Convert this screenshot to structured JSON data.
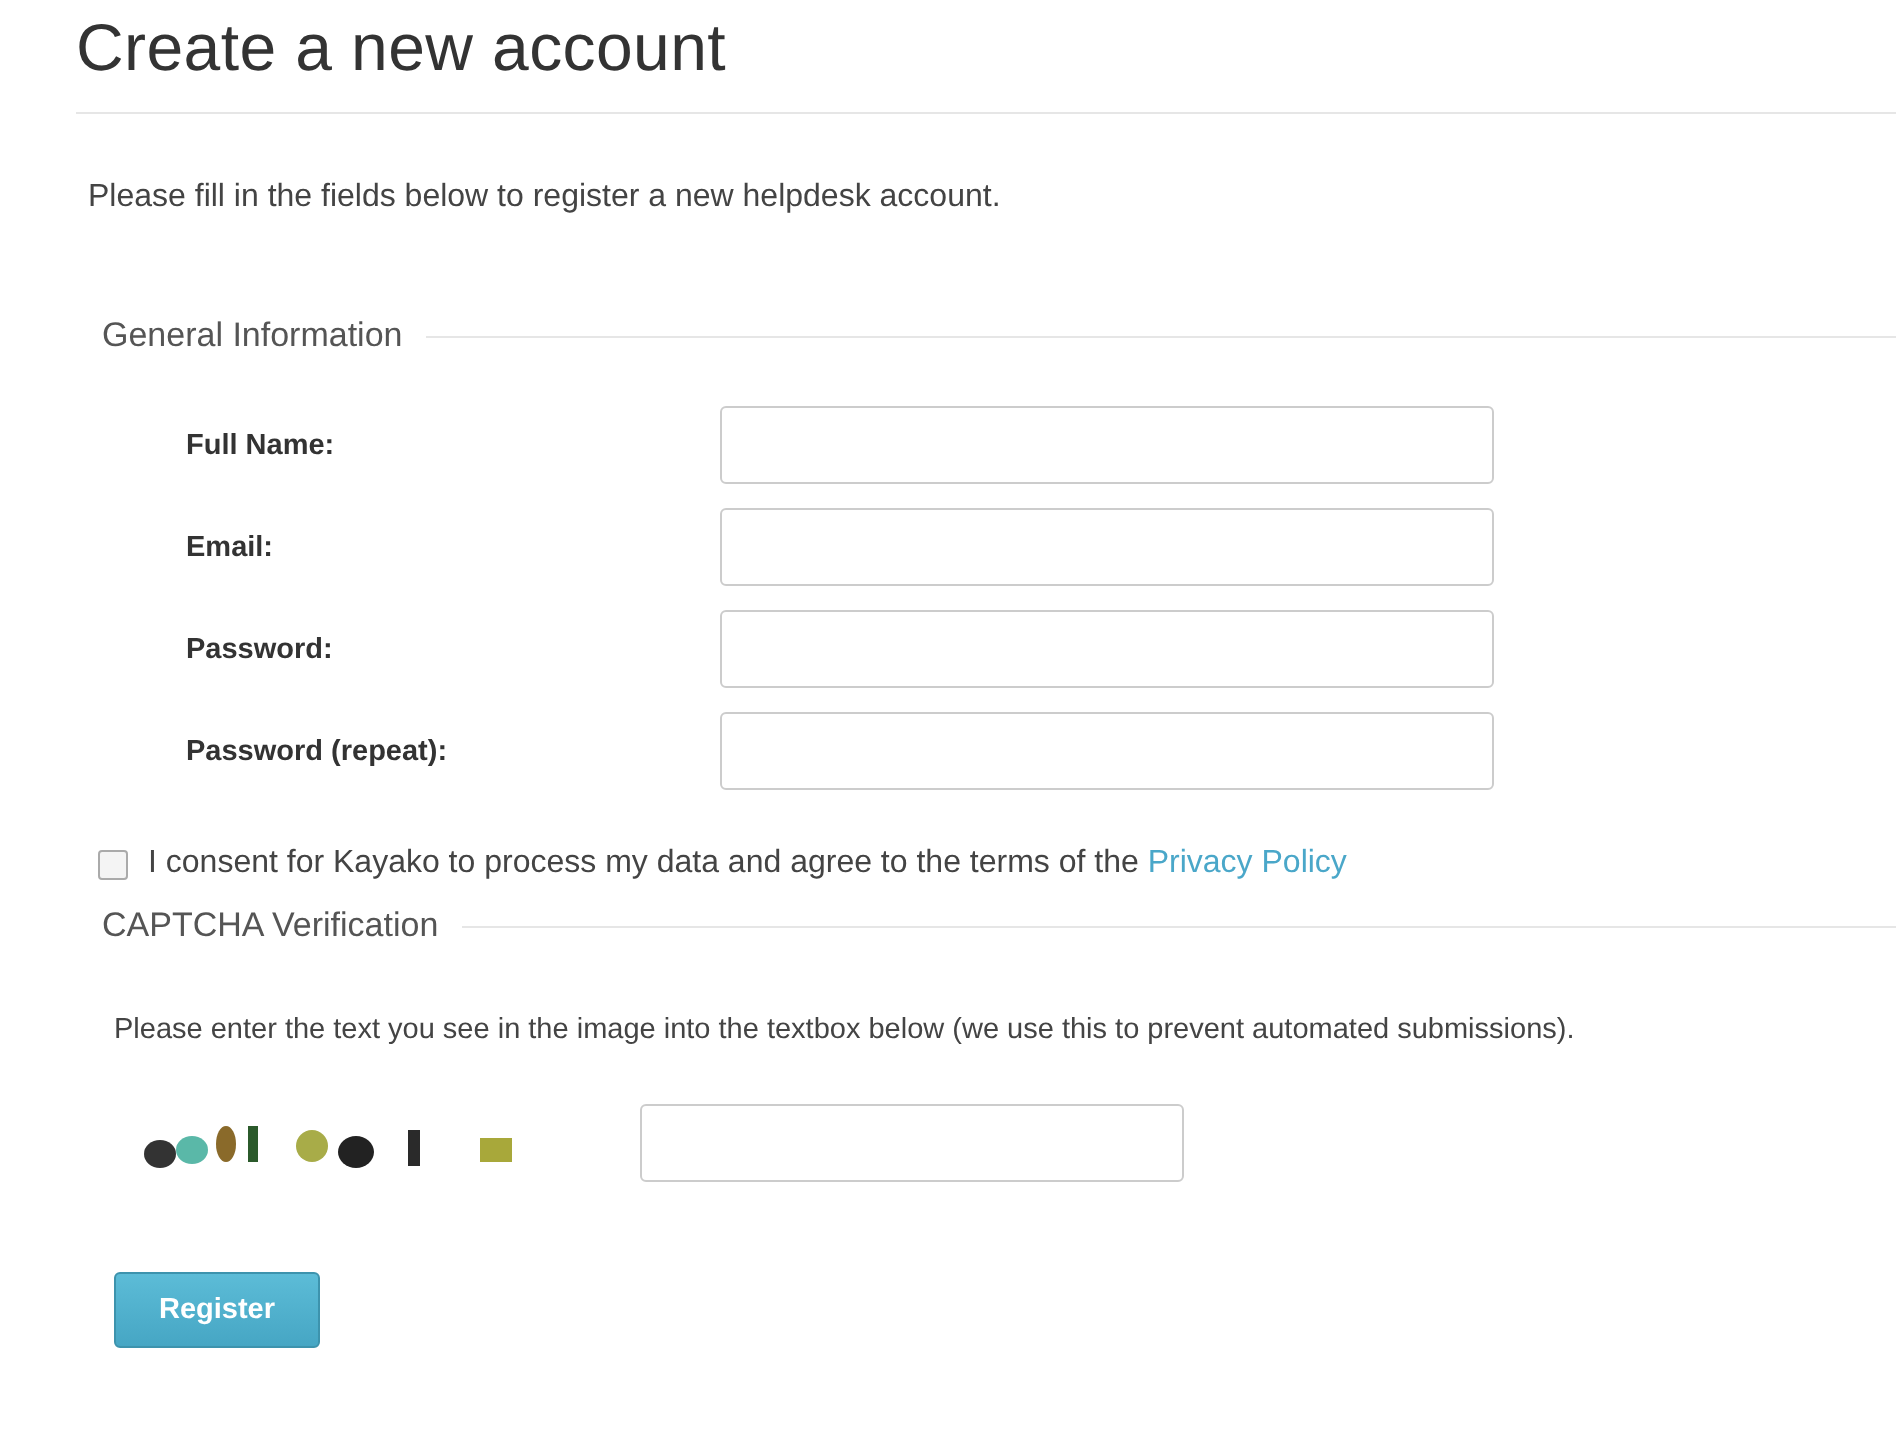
{
  "title": "Create a new account",
  "intro": "Please fill in the fields below to register a new helpdesk account.",
  "general_section": {
    "legend": "General Information",
    "fields": [
      {
        "label": "Full Name:"
      },
      {
        "label": "Email:"
      },
      {
        "label": "Password:"
      },
      {
        "label": "Password (repeat):"
      }
    ]
  },
  "consent": {
    "checked": false,
    "text": "I consent for Kayako to process my data and agree to the terms of the",
    "link": "Privacy Policy"
  },
  "captcha_section": {
    "legend": "CAPTCHA Verification",
    "help": "Please enter the text you see in the image into the textbox below (we use this to prevent automated submissions)."
  },
  "submit_button": "Register"
}
